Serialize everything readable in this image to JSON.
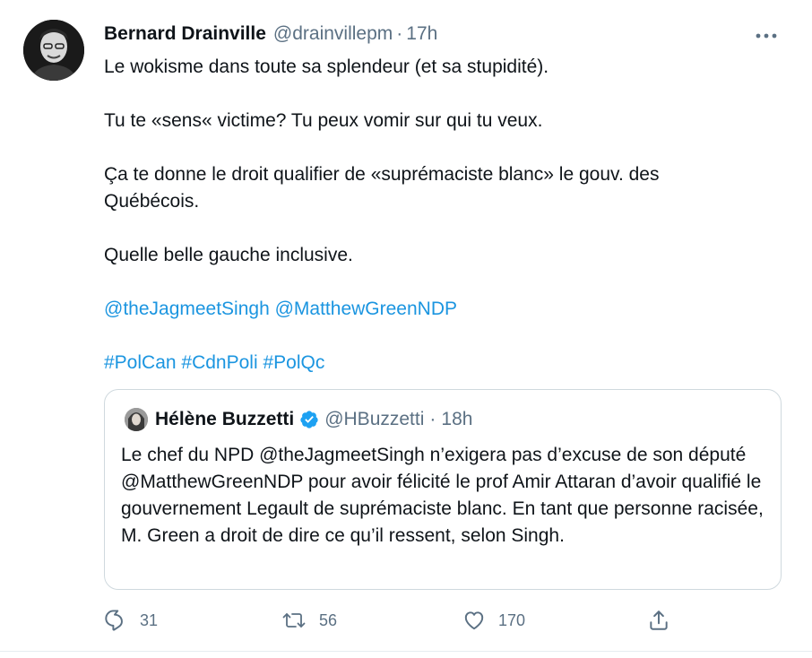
{
  "tweet": {
    "author_name": "Bernard Drainville",
    "author_handle": "@drainvillepm",
    "separator": "·",
    "time": "17h",
    "lines": {
      "p1": "Le wokisme dans toute sa splendeur (et sa stupidité).",
      "p2": "Tu te «sens« victime? Tu peux vomir sur qui tu veux.",
      "p3": "Ça te donne le droit qualifier de «suprémaciste blanc» le gouv. des Québécois.",
      "p4": "Quelle belle gauche inclusive.",
      "mention1": "@theJagmeetSingh",
      "mention2": "@MatthewGreenNDP",
      "hashtag1": "#PolCan",
      "hashtag2": "#CdnPoli",
      "hashtag3": "#PolQc"
    }
  },
  "quote": {
    "author_name": "Hélène Buzzetti",
    "author_handle": "@HBuzzetti",
    "separator": "·",
    "time": "18h",
    "verified": true,
    "text": "Le chef du NPD @theJagmeetSingh n’exigera pas d’excuse de son député @MatthewGreenNDP pour avoir félicité le prof Amir Attaran d’avoir qualifié le gouvernement Legault de suprémaciste blanc. En tant que personne racisée, M. Green a droit de dire ce qu’il ressent, selon Singh."
  },
  "actions": {
    "reply_count": "31",
    "retweet_count": "56",
    "like_count": "170"
  },
  "icons": {
    "more": "more-dots-icon",
    "verified": "verified-badge-icon",
    "reply": "reply-icon",
    "retweet": "retweet-icon",
    "like": "heart-icon",
    "share": "share-icon"
  },
  "colors": {
    "link": "#1b95e0",
    "secondary_text": "#5b7083",
    "verified": "#1da1f2",
    "border": "#cfd9de"
  }
}
